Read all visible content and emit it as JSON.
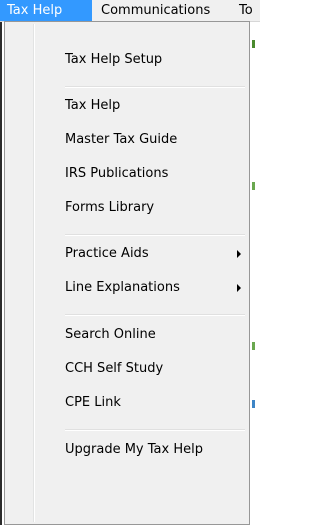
{
  "menubar": {
    "items": [
      {
        "label": "Tax Help"
      },
      {
        "label": "Communications"
      },
      {
        "label": "To"
      }
    ]
  },
  "dropdown": {
    "items": [
      {
        "label": "Tax Help Setup"
      },
      {
        "label": "Tax Help"
      },
      {
        "label": "Master Tax Guide"
      },
      {
        "label": "IRS Publications"
      },
      {
        "label": "Forms Library"
      },
      {
        "label": "Practice Aids",
        "submenu": true
      },
      {
        "label": "Line Explanations",
        "submenu": true
      },
      {
        "label": "Search Online"
      },
      {
        "label": "CCH Self Study"
      },
      {
        "label": "CPE Link"
      },
      {
        "label": "Upgrade My Tax Help"
      }
    ]
  },
  "colors": {
    "menu_highlight": "#3399ff",
    "menu_background": "#f0f0f0",
    "menu_border": "#979797"
  }
}
